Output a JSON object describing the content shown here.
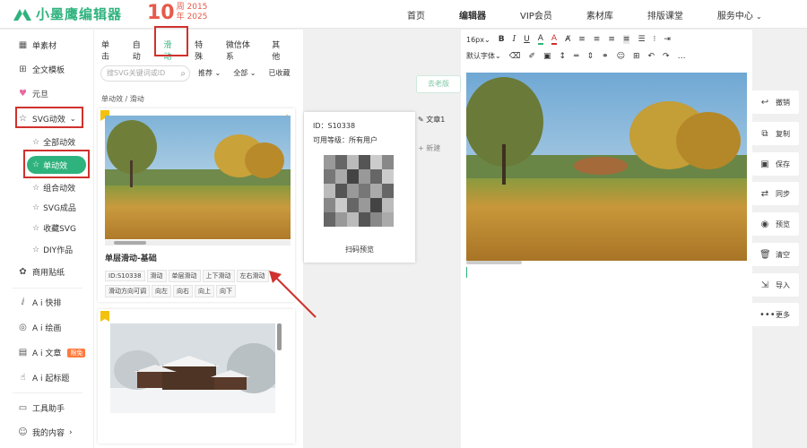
{
  "brand": {
    "name": "小墨鹰编辑器",
    "anniv_number": "10",
    "anniv_line1": "周 2015",
    "anniv_line2": "年 2025",
    "brand_color": "#2fb37e",
    "anniv_color": "#e65a4a"
  },
  "nav": [
    "首页",
    "编辑器",
    "VIP会员",
    "素材库",
    "排版课堂",
    "服务中心"
  ],
  "sidebar": {
    "items": [
      {
        "label": "单素材",
        "icon": "single-material-icon"
      },
      {
        "label": "全文模板",
        "icon": "template-icon"
      },
      {
        "label": "元旦",
        "icon": "festival-icon"
      },
      {
        "label": "SVG动效",
        "icon": "star-icon"
      }
    ],
    "sub": [
      {
        "label": "全部动效"
      },
      {
        "label": "单动效"
      },
      {
        "label": "组合动效"
      },
      {
        "label": "SVG成品"
      },
      {
        "label": "收藏SVG"
      },
      {
        "label": "DIY作品"
      }
    ],
    "lower": [
      {
        "label": "商用贴纸"
      },
      {
        "label": "A i 快排"
      },
      {
        "label": "A i 绘画"
      },
      {
        "label": "A i 文章",
        "badge": "限免"
      },
      {
        "label": "A i 起标题"
      },
      {
        "label": "工具助手"
      },
      {
        "label": "我的内容"
      }
    ]
  },
  "panel": {
    "tabs": [
      "单击",
      "自动",
      "滑动",
      "特殊",
      "微信体系",
      "其他"
    ],
    "search_placeholder": "搜SVG关键词或ID",
    "filters": [
      "推荐",
      "全部",
      "已收藏"
    ],
    "crumb": "单动效 / 滑动",
    "card1": {
      "title": "单层滑动-基础",
      "tags": [
        "ID:S10338",
        "滑动",
        "单层滑动",
        "上下滑动",
        "左右滑动",
        "滑动方向可调",
        "向左",
        "向右",
        "向上",
        "向下"
      ]
    }
  },
  "popup": {
    "id_line": "ID：S10338",
    "level_line": "可用等级：所有用户",
    "scan_label": "扫码预览"
  },
  "middle": {
    "old_button": "去老版",
    "doc_name": "文章1",
    "new_doc": "新建"
  },
  "toolbar": {
    "font_size": "16px",
    "font_family": "默认字体"
  },
  "rail": [
    "撤销",
    "复制",
    "保存",
    "同步",
    "预览",
    "清空",
    "导入",
    "更多"
  ]
}
